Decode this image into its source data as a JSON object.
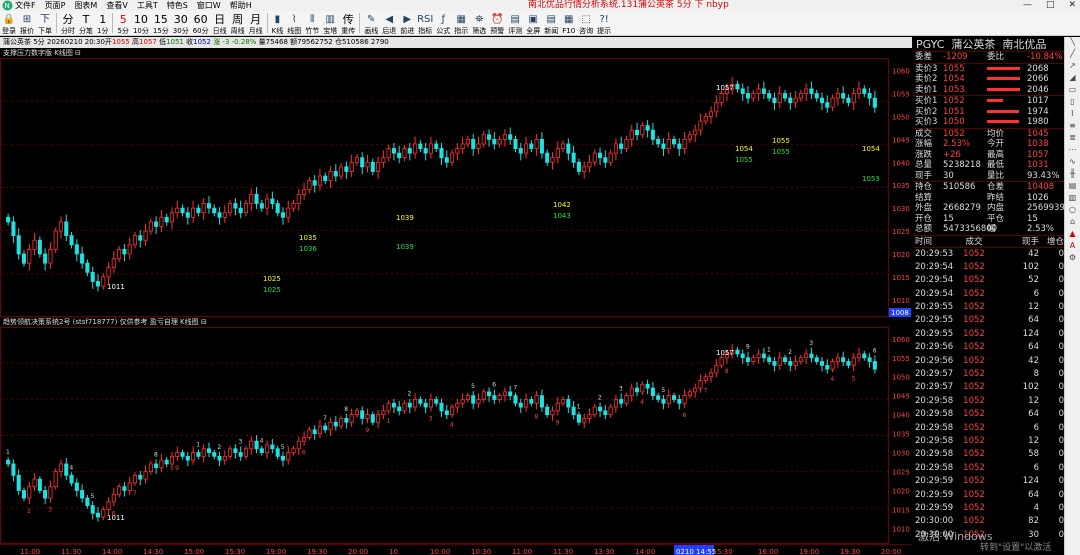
{
  "window": {
    "title": "南北优品行情分析系统.131蒲公英茶 5分 下 nbyp",
    "min": "—",
    "max": "□",
    "close": "✕"
  },
  "menu": [
    "文件F",
    "页面P",
    "图表M",
    "查看V",
    "工具T",
    "特色S",
    "窗口W",
    "帮助H"
  ],
  "toolbar": [
    {
      "label": "登录",
      "icon": "lock-icon",
      "glyph": "🔒"
    },
    {
      "label": "报价",
      "icon": "quote-icon",
      "glyph": "⊞"
    },
    {
      "label": "下单",
      "icon": "order-icon",
      "glyph": "下"
    },
    {
      "label": "分时",
      "big": "分"
    },
    {
      "label": "分笔",
      "big": "T"
    },
    {
      "label": "1分",
      "big": "1"
    },
    {
      "label": "5分",
      "big": "5",
      "red": true
    },
    {
      "label": "10分",
      "big": "10"
    },
    {
      "label": "15分",
      "big": "15"
    },
    {
      "label": "30分",
      "big": "30"
    },
    {
      "label": "60分",
      "big": "60"
    },
    {
      "label": "日线",
      "big": "日"
    },
    {
      "label": "周线",
      "big": "周"
    },
    {
      "label": "月线",
      "big": "月"
    },
    {
      "label": "K线",
      "icon": "kline-icon",
      "glyph": "▮"
    },
    {
      "label": "线图",
      "icon": "line-icon",
      "glyph": "⌇"
    },
    {
      "label": "竹节",
      "icon": "bamboo-icon",
      "glyph": "⦀"
    },
    {
      "label": "宝塔",
      "icon": "tower-icon",
      "glyph": "▥"
    },
    {
      "label": "重传",
      "big": "传"
    },
    {
      "label": "画线",
      "icon": "draw-icon",
      "glyph": "✎"
    },
    {
      "label": "后退",
      "icon": "back-icon",
      "glyph": "◀"
    },
    {
      "label": "前进",
      "icon": "forward-icon",
      "glyph": "▶"
    },
    {
      "label": "指标",
      "icon": "indicator-icon",
      "glyph": "RSI"
    },
    {
      "label": "公式",
      "icon": "formula-icon",
      "glyph": "ƒ"
    },
    {
      "label": "指示",
      "icon": "hint-icon",
      "glyph": "▦"
    },
    {
      "label": "筛选",
      "icon": "filter-icon",
      "glyph": "⛯"
    },
    {
      "label": "预警",
      "icon": "alarm-icon",
      "glyph": "⏰"
    },
    {
      "label": "评测",
      "icon": "eval-icon",
      "glyph": "▤"
    },
    {
      "label": "全屏",
      "icon": "fullscreen-icon",
      "glyph": "▣"
    },
    {
      "label": "新闻",
      "icon": "news-icon",
      "glyph": "▤"
    },
    {
      "label": "F10",
      "icon": "f10-icon",
      "glyph": "▦"
    },
    {
      "label": "咨询",
      "icon": "consult-icon",
      "glyph": "⬚"
    },
    {
      "label": "提示",
      "icon": "tip-icon",
      "glyph": "?!"
    }
  ],
  "infobar": {
    "name": "蒲公英茶 5分 20260210 20:30开",
    "open": "1055",
    "high_l": "高",
    "high": "1057",
    "low_l": "低",
    "low": "1051",
    "close_l": "收",
    "close": "1052",
    "chg": "涨 -3 -0.28%",
    "vol": "量75468 额79562752 仓510586 2790"
  },
  "panel1": {
    "title": "支撑压力数字版 K线图 ⊟"
  },
  "panel2": {
    "title": "趋势领航决策系统2号 (stsf718777) 仅供参考 盈亏自理 K线图 ⊟"
  },
  "axis_top": [
    "1060",
    "1055",
    "1050",
    "1045",
    "1040",
    "1035",
    "1030",
    "1025",
    "1020",
    "1015",
    "1010"
  ],
  "axis_top_badge": "1008",
  "axis_bot": [
    "1060",
    "1055",
    "1050",
    "1045",
    "1040",
    "1035",
    "1030",
    "1025",
    "1020",
    "1015",
    "1010"
  ],
  "time_labels": [
    "11:00",
    "11:30",
    "14:00",
    "14:30",
    "15:00",
    "15:30",
    "19:00",
    "19:30",
    "20:00",
    "10",
    "10:00",
    "10:30",
    "11:00",
    "11:30",
    "13:30",
    "14:00",
    "0210 14:55",
    "5:30",
    "16:00",
    "19:00",
    "19:30",
    "20:00"
  ],
  "chart_data": {
    "type": "candlestick",
    "ylim": [
      1008,
      1061
    ],
    "annotations_top": [
      {
        "text": "1011",
        "color": "white"
      },
      {
        "text": "1025",
        "color": "yellow"
      },
      {
        "text": "1025",
        "color": "green"
      },
      {
        "text": "1035",
        "color": "yellow"
      },
      {
        "text": "1036",
        "color": "green"
      },
      {
        "text": "1039",
        "color": "yellow"
      },
      {
        "text": "1039",
        "color": "green"
      },
      {
        "text": "1042",
        "color": "yellow"
      },
      {
        "text": "1043",
        "color": "green"
      },
      {
        "text": "1057",
        "color": "white"
      },
      {
        "text": "1054",
        "color": "yellow"
      },
      {
        "text": "1055",
        "color": "green"
      },
      {
        "text": "1055",
        "color": "yellow"
      },
      {
        "text": "1055",
        "color": "green"
      },
      {
        "text": "1054",
        "color": "yellow"
      },
      {
        "text": "1053",
        "color": "green"
      }
    ],
    "closes": [
      1027,
      1024,
      1020,
      1018,
      1021,
      1023,
      1020,
      1018,
      1021,
      1025,
      1027,
      1024,
      1022,
      1020,
      1018,
      1016,
      1014,
      1013,
      1015,
      1017,
      1019,
      1021,
      1020,
      1022,
      1024,
      1023,
      1025,
      1027,
      1026,
      1028,
      1027,
      1029,
      1030,
      1029,
      1028,
      1030,
      1029,
      1031,
      1030,
      1029,
      1028,
      1029,
      1031,
      1030,
      1029,
      1031,
      1033,
      1031,
      1030,
      1032,
      1031,
      1029,
      1028,
      1030,
      1031,
      1033,
      1034,
      1036,
      1035,
      1037,
      1036,
      1038,
      1037,
      1039,
      1038,
      1040,
      1041,
      1039,
      1040,
      1038,
      1040,
      1041,
      1043,
      1042,
      1041,
      1043,
      1042,
      1044,
      1043,
      1042,
      1044,
      1043,
      1041,
      1040,
      1042,
      1043,
      1044,
      1045,
      1043,
      1044,
      1046,
      1045,
      1044,
      1045,
      1046,
      1045,
      1043,
      1042,
      1044,
      1043,
      1045,
      1042,
      1040,
      1041,
      1043,
      1044,
      1042,
      1040,
      1038,
      1039,
      1040,
      1042,
      1041,
      1040,
      1042,
      1044,
      1043,
      1045,
      1047,
      1046,
      1048,
      1047,
      1045,
      1044,
      1043,
      1045,
      1044,
      1043,
      1045,
      1046,
      1047,
      1049,
      1050,
      1051,
      1053,
      1055,
      1056,
      1057,
      1056,
      1055,
      1054,
      1055,
      1056,
      1055,
      1054,
      1053,
      1055,
      1054,
      1053,
      1054,
      1055,
      1056,
      1055,
      1054,
      1053,
      1052,
      1054,
      1055,
      1054,
      1053,
      1055,
      1056,
      1055,
      1054,
      1052
    ]
  },
  "quote": {
    "code": "PGYC",
    "name": "蒲公英茶",
    "market": "南北优品",
    "diff": {
      "l": "委差",
      "v": "-1209",
      "l2": "委比",
      "v2": "-10.84%"
    },
    "asks": [
      {
        "l": "卖价3",
        "p": "1055",
        "q": "2068",
        "w": 0.87
      },
      {
        "l": "卖价2",
        "p": "1054",
        "q": "2066",
        "w": 0.87
      },
      {
        "l": "卖价1",
        "p": "1053",
        "q": "2046",
        "w": 0.86
      }
    ],
    "bids": [
      {
        "l": "买价1",
        "p": "1052",
        "q": "1017",
        "w": 0.43
      },
      {
        "l": "买价2",
        "p": "1051",
        "q": "1974",
        "w": 0.83
      },
      {
        "l": "买价3",
        "p": "1050",
        "q": "1980",
        "w": 0.83
      }
    ],
    "stats": [
      {
        "l": "成交",
        "v": "1052",
        "c": "red",
        "l2": "均价",
        "v2": "1045",
        "c2": "red"
      },
      {
        "l": "涨幅",
        "v": "2.53%",
        "c": "red",
        "l2": "今开",
        "v2": "1038",
        "c2": "red"
      },
      {
        "l": "涨跌",
        "v": "+26",
        "c": "red",
        "l2": "最高",
        "v2": "1057",
        "c2": "red"
      },
      {
        "l": "总量",
        "v": "5238218",
        "c": "white",
        "l2": "最低",
        "v2": "1031",
        "c2": "red"
      },
      {
        "l": "现手",
        "v": "30",
        "c": "white",
        "l2": "量比",
        "v2": "93.43%",
        "c2": "white"
      }
    ],
    "stats2": [
      {
        "l": "持仓",
        "v": "510586",
        "c": "white",
        "l2": "仓差",
        "v2": "10408",
        "c2": "red"
      },
      {
        "l": "结算",
        "v": "",
        "c": "white",
        "l2": "昨结",
        "v2": "1026",
        "c2": "white"
      },
      {
        "l": "外盘",
        "v": "2668279",
        "c": "white",
        "l2": "内盘",
        "v2": "2569939",
        "c2": "white"
      },
      {
        "l": "开仓",
        "v": "15",
        "c": "white",
        "l2": "平仓",
        "v2": "15",
        "c2": "white"
      },
      {
        "l": "总额",
        "v": "5473356800",
        "c": "white",
        "l2": "幅",
        "v2": "2.53%",
        "c2": "white"
      }
    ],
    "tick_header": [
      "时间",
      "成交",
      "现手",
      "增仓"
    ],
    "ticks": [
      [
        "20:29:53",
        "1052",
        "42",
        "0"
      ],
      [
        "20:29:54",
        "1052",
        "102",
        "0"
      ],
      [
        "20:29:54",
        "1052",
        "52",
        "0"
      ],
      [
        "20:29:54",
        "1052",
        "6",
        "0"
      ],
      [
        "20:29:55",
        "1052",
        "12",
        "0"
      ],
      [
        "20:29:55",
        "1052",
        "64",
        "0"
      ],
      [
        "20:29:55",
        "1052",
        "124",
        "0"
      ],
      [
        "20:29:56",
        "1052",
        "64",
        "0"
      ],
      [
        "20:29:56",
        "1052",
        "42",
        "0"
      ],
      [
        "20:29:57",
        "1052",
        "8",
        "0"
      ],
      [
        "20:29:57",
        "1052",
        "102",
        "0"
      ],
      [
        "20:29:58",
        "1052",
        "12",
        "0"
      ],
      [
        "20:29:58",
        "1052",
        "64",
        "0"
      ],
      [
        "20:29:58",
        "1052",
        "6",
        "0"
      ],
      [
        "20:29:58",
        "1052",
        "12",
        "0"
      ],
      [
        "20:29:58",
        "1052",
        "58",
        "0"
      ],
      [
        "20:29:58",
        "1052",
        "6",
        "0"
      ],
      [
        "20:29:59",
        "1052",
        "124",
        "0"
      ],
      [
        "20:29:59",
        "1052",
        "64",
        "0"
      ],
      [
        "20:29:59",
        "1052",
        "4",
        "0"
      ],
      [
        "20:30:00",
        "1052",
        "82",
        "0"
      ],
      [
        "20:30:00",
        "1052",
        "30",
        "0"
      ]
    ]
  },
  "watermark": "激活 Windows",
  "watermark2": "转到\"设置\"以激活 Windows。"
}
